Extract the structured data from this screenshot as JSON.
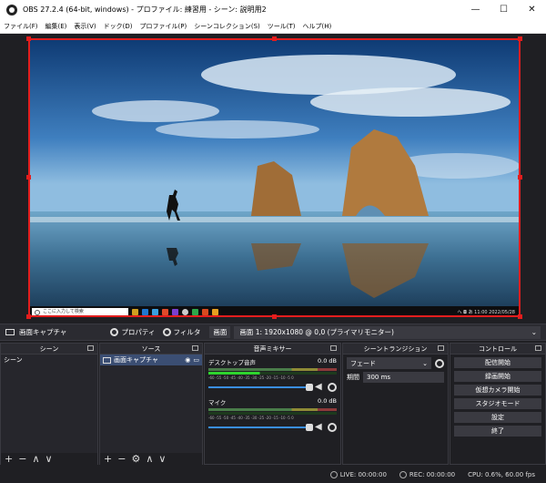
{
  "window": {
    "title": "OBS 27.2.4 (64-bit, windows) - プロファイル: 練習用 - シーン: 説明用2",
    "minimize": "—",
    "maximize": "☐",
    "close": "✕"
  },
  "menu": [
    "ファイル(F)",
    "編集(E)",
    "表示(V)",
    "ドック(D)",
    "プロファイル(P)",
    "シーンコレクション(S)",
    "ツール(T)",
    "ヘルプ(H)"
  ],
  "preview": {
    "search_placeholder": "ここに入力して検索",
    "tray_text": "へ ◘ あ 11:00 2022/05/28"
  },
  "source_bar": {
    "name": "画面キャプチャ",
    "properties": "プロパティ",
    "filters": "フィルタ",
    "display_label": "画面",
    "display_value": "画面 1: 1920x1080 @ 0,0 (プライマリモニター)"
  },
  "docks": {
    "scenes": {
      "title": "シーン",
      "items": [
        "シーン"
      ]
    },
    "sources": {
      "title": "ソース",
      "items": [
        "画面キャプチャ"
      ]
    },
    "mixer": {
      "title": "音声ミキサー",
      "scale": "-60 -55 -50 -45 -40 -35 -30 -25 -20 -15 -10 -5 0",
      "channels": [
        {
          "name": "デスクトップ音声",
          "db": "0.0 dB"
        },
        {
          "name": "マイク",
          "db": "0.0 dB"
        }
      ]
    },
    "transitions": {
      "title": "シーントランジション",
      "type": "フェード",
      "duration_label": "期間",
      "duration_value": "300 ms"
    },
    "controls": {
      "title": "コントロール",
      "buttons": [
        "配信開始",
        "録画開始",
        "仮想カメラ開始",
        "スタジオモード",
        "設定",
        "終了"
      ]
    }
  },
  "status": {
    "live": "LIVE: 00:00:00",
    "rec": "REC: 00:00:00",
    "cpu": "CPU: 0.6%, 60.00 fps"
  },
  "colors": {
    "accent": "#e31d1d",
    "selected": "#3b4e73"
  }
}
